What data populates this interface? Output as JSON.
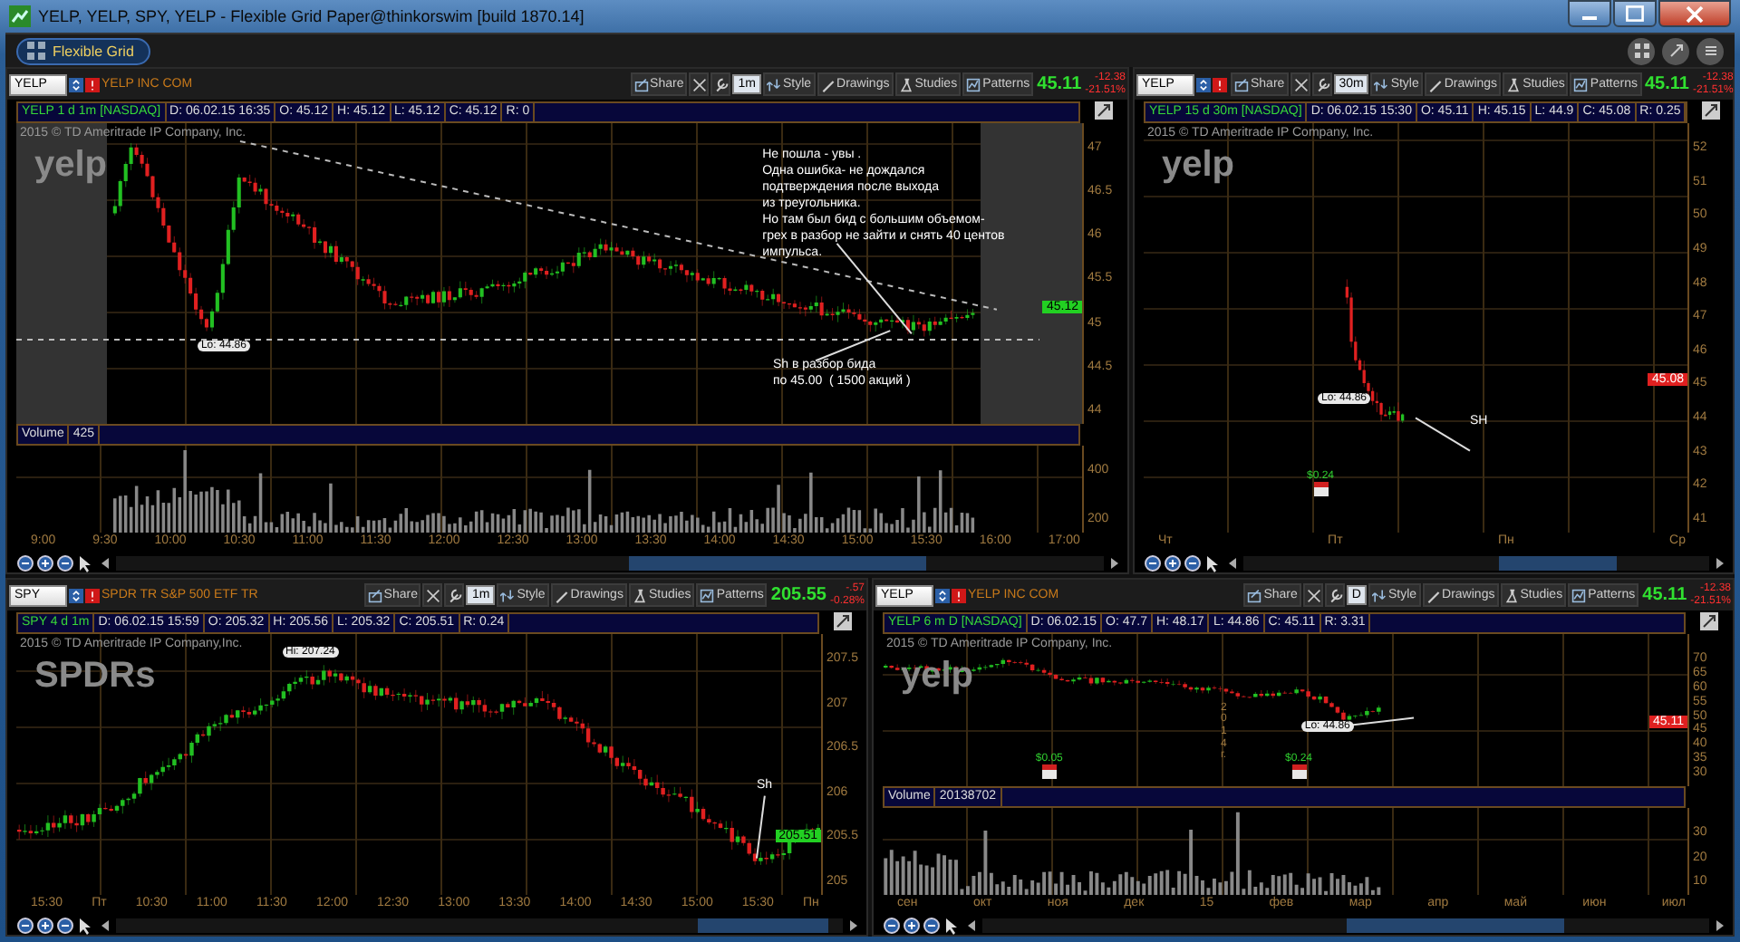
{
  "window": {
    "title": "YELP, YELP, SPY, YELP - Flexible Grid Paper@thinkorswim [build 1870.14]"
  },
  "tab": {
    "label": "Flexible Grid",
    "selected": true
  },
  "panels": [
    {
      "symbol": "YELP",
      "company": "YELP INC COM",
      "buttons": [
        "Share",
        "Style",
        "Drawings",
        "Studies",
        "Patterns"
      ],
      "timeframe": "1m",
      "last": "45.11",
      "change": "-12.38",
      "change_pct": "-21.51%",
      "info": [
        "YELP 1 d 1m [NASDAQ]",
        "D: 06.02.15 16:35",
        "O: 45.12",
        "H: 45.12",
        "L: 45.12",
        "C: 45.12",
        "R: 0"
      ],
      "copyright": "2015 © TD Ameritrade IP Company, Inc.",
      "logo": "yelp",
      "price_axis": [
        "47",
        "46.5",
        "46",
        "45.5",
        "45",
        "44.5",
        "44"
      ],
      "price_badge": {
        "text": "45.12",
        "kind": "up"
      },
      "labels": [
        {
          "kind": "bubble",
          "text": "Lo: 44.86"
        },
        {
          "kind": "note",
          "text": "Не пошла - увы .\nОдна ошибка- не дождался\nподтверждения после выхода\nиз треугольника.\nНо там был бид с большим объемом-\nгрех в разбор не зайти и снять 40 центов\nимпульса."
        },
        {
          "kind": "note",
          "text": "Sh в разбор бида\nпо 45.00  ( 1500 акций )"
        }
      ],
      "volume": {
        "label": "Volume",
        "value": "425",
        "axis": [
          "400",
          "200"
        ]
      },
      "time_axis": [
        "9:00",
        "9:30",
        "10:00",
        "10:30",
        "11:00",
        "11:30",
        "12:00",
        "12:30",
        "13:00",
        "13:30",
        "14:00",
        "14:30",
        "15:00",
        "15:30",
        "16:00",
        "17:00"
      ]
    },
    {
      "symbol": "YELP",
      "buttons": [
        "Share",
        "Style",
        "Drawings",
        "Studies",
        "Patterns"
      ],
      "timeframe": "30m",
      "last": "45.11",
      "change": "-12.38",
      "change_pct": "-21.51%",
      "info": [
        "YELP 15 d 30m [NASDAQ]",
        "D: 06.02.15 15:30",
        "O: 45.11",
        "H: 45.15",
        "L: 44.9",
        "C: 45.08",
        "R: 0.25"
      ],
      "copyright": "2015 © TD Ameritrade IP Company, Inc.",
      "logo": "yelp",
      "price_axis": [
        "52",
        "51",
        "50",
        "49",
        "48",
        "47",
        "46",
        "45",
        "44",
        "43",
        "42",
        "41"
      ],
      "price_badge": {
        "text": "45.08",
        "kind": "down"
      },
      "labels": [
        {
          "kind": "bubble",
          "text": "Lo: 44.86"
        },
        {
          "kind": "note",
          "text": "SH"
        },
        {
          "kind": "dividend",
          "text": "$0.24"
        }
      ],
      "time_axis": [
        "Чт",
        "Пт",
        "Пн",
        "Ср"
      ]
    },
    {
      "symbol": "SPY",
      "company": "SPDR TR S&P 500 ETF TR",
      "buttons": [
        "Share",
        "Style",
        "Drawings",
        "Studies",
        "Patterns"
      ],
      "timeframe": "1m",
      "last": "205.55",
      "change": "-.57",
      "change_pct": "-0.28%",
      "info": [
        "SPY 4 d 1m",
        "D: 06.02.15 15:59",
        "O: 205.32",
        "H: 205.56",
        "L: 205.32",
        "C: 205.51",
        "R: 0.24"
      ],
      "copyright": "2015 © TD Ameritrade IP Company,Inc.",
      "logo": "SPDRs",
      "price_axis": [
        "207.5",
        "207",
        "206.5",
        "206",
        "205.5",
        "205"
      ],
      "price_badge": {
        "text": "205.51",
        "kind": "up"
      },
      "labels": [
        {
          "kind": "bubble",
          "text": "Hi: 207.24"
        },
        {
          "kind": "note",
          "text": "Sh"
        }
      ],
      "time_axis": [
        "15:30",
        "Пт",
        "10:30",
        "11:00",
        "11:30",
        "12:00",
        "12:30",
        "13:00",
        "13:30",
        "14:00",
        "14:30",
        "15:00",
        "15:30",
        "Пн"
      ]
    },
    {
      "symbol": "YELP",
      "company": "YELP INC COM",
      "buttons": [
        "Share",
        "Style",
        "Drawings",
        "Studies",
        "Patterns"
      ],
      "timeframe": "D",
      "last": "45.11",
      "change": "-12.38",
      "change_pct": "-21.51%",
      "info": [
        "YELP 6 m D [NASDAQ]",
        "D: 06.02.15",
        "O: 47.7",
        "H: 48.17",
        "L: 44.86",
        "C: 45.11",
        "R: 3.31"
      ],
      "copyright": "2015 © TD Ameritrade IP Company, Inc.",
      "logo": "yelp",
      "price_axis": [
        "70",
        "65",
        "60",
        "55",
        "50",
        "45",
        "40",
        "35",
        "30"
      ],
      "price_badge": {
        "text": "45.11",
        "kind": "down"
      },
      "labels": [
        {
          "kind": "bubble",
          "text": "Lo: 44.86"
        },
        {
          "kind": "dividend",
          "text": "$0.05"
        },
        {
          "kind": "dividend",
          "text": "$0.24"
        },
        {
          "kind": "vertical",
          "text": "2014 г."
        }
      ],
      "volume": {
        "label": "Volume",
        "value": "20138702",
        "axis": [
          "30",
          "20",
          "10"
        ]
      },
      "time_axis": [
        "сен",
        "окт",
        "ноя",
        "дек",
        "15",
        "фев",
        "мар",
        "апр",
        "май",
        "июн",
        "июл"
      ]
    }
  ]
}
